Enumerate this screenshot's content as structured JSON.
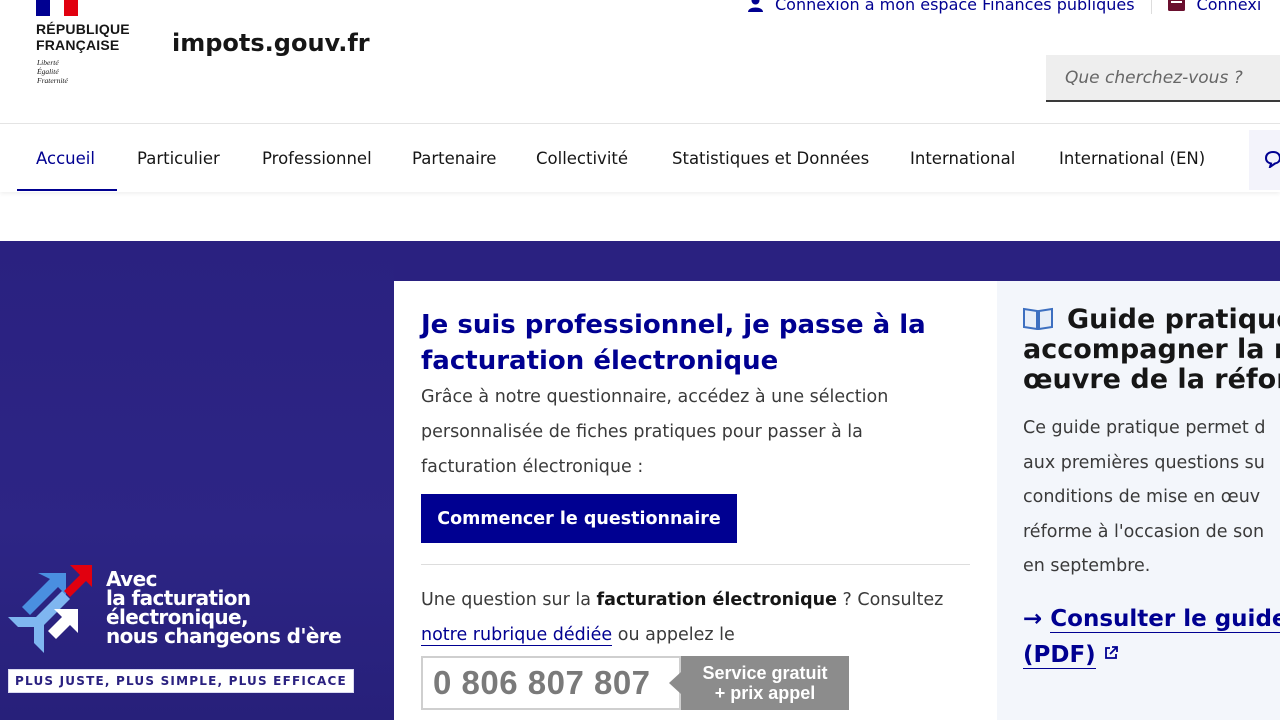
{
  "header": {
    "republic_name": "RÉPUBLIQUE\nFRANÇAISE",
    "motto": "Liberté\nÉgalité\nFraternité",
    "site_name": "impots.gouv.fr",
    "top_links": [
      {
        "label": "Connexion à mon espace Finances publiques",
        "icon": "user-icon"
      },
      {
        "label": "Connexi",
        "icon": "id-card-icon"
      }
    ],
    "search": {
      "placeholder": "Que cherchez-vous ?"
    }
  },
  "nav": {
    "items": [
      {
        "label": "Accueil",
        "active": true
      },
      {
        "label": "Particulier"
      },
      {
        "label": "Professionnel"
      },
      {
        "label": "Partenaire"
      },
      {
        "label": "Collectivité"
      },
      {
        "label": "Statistiques et Données"
      },
      {
        "label": "International"
      },
      {
        "label": "International (EN)"
      }
    ]
  },
  "promo": {
    "headline": "Avec\nla facturation\nélectronique,\nnous changeons d'ère",
    "strap": "PLUS JUSTE, PLUS SIMPLE, PLUS EFFICACE"
  },
  "card_pro": {
    "title": "Je suis professionnel, je passe à la facturation électronique",
    "description": "Grâce à notre questionnaire, accédez à une sélection personnalisée de fiches pratiques pour passer à la facturation électronique :",
    "button_label": "Commencer le questionnaire",
    "question_prefix": "Une question sur la ",
    "question_bold": "facturation électronique",
    "question_mid": " ? Consultez ",
    "question_link": "notre rubrique dédiée",
    "question_suffix": " ou appelez le",
    "phone_number": "0 806 807 807",
    "phone_tag": "Service gratuit\n+ prix appel"
  },
  "card_guide": {
    "title_lines": [
      "Guide pratique",
      "accompagner la m",
      "œuvre de la réforn"
    ],
    "description_lines": [
      "Ce guide pratique permet d",
      "aux premières questions su",
      "conditions de mise en œuv",
      "réforme à l'occasion de son",
      "en septembre."
    ],
    "link_lines": [
      "Consulter le guide p",
      "(PDF)"
    ]
  },
  "colors": {
    "brand_blue": "#000091",
    "hero_purple": "#2a2180",
    "marianne_red": "#e1000f"
  }
}
